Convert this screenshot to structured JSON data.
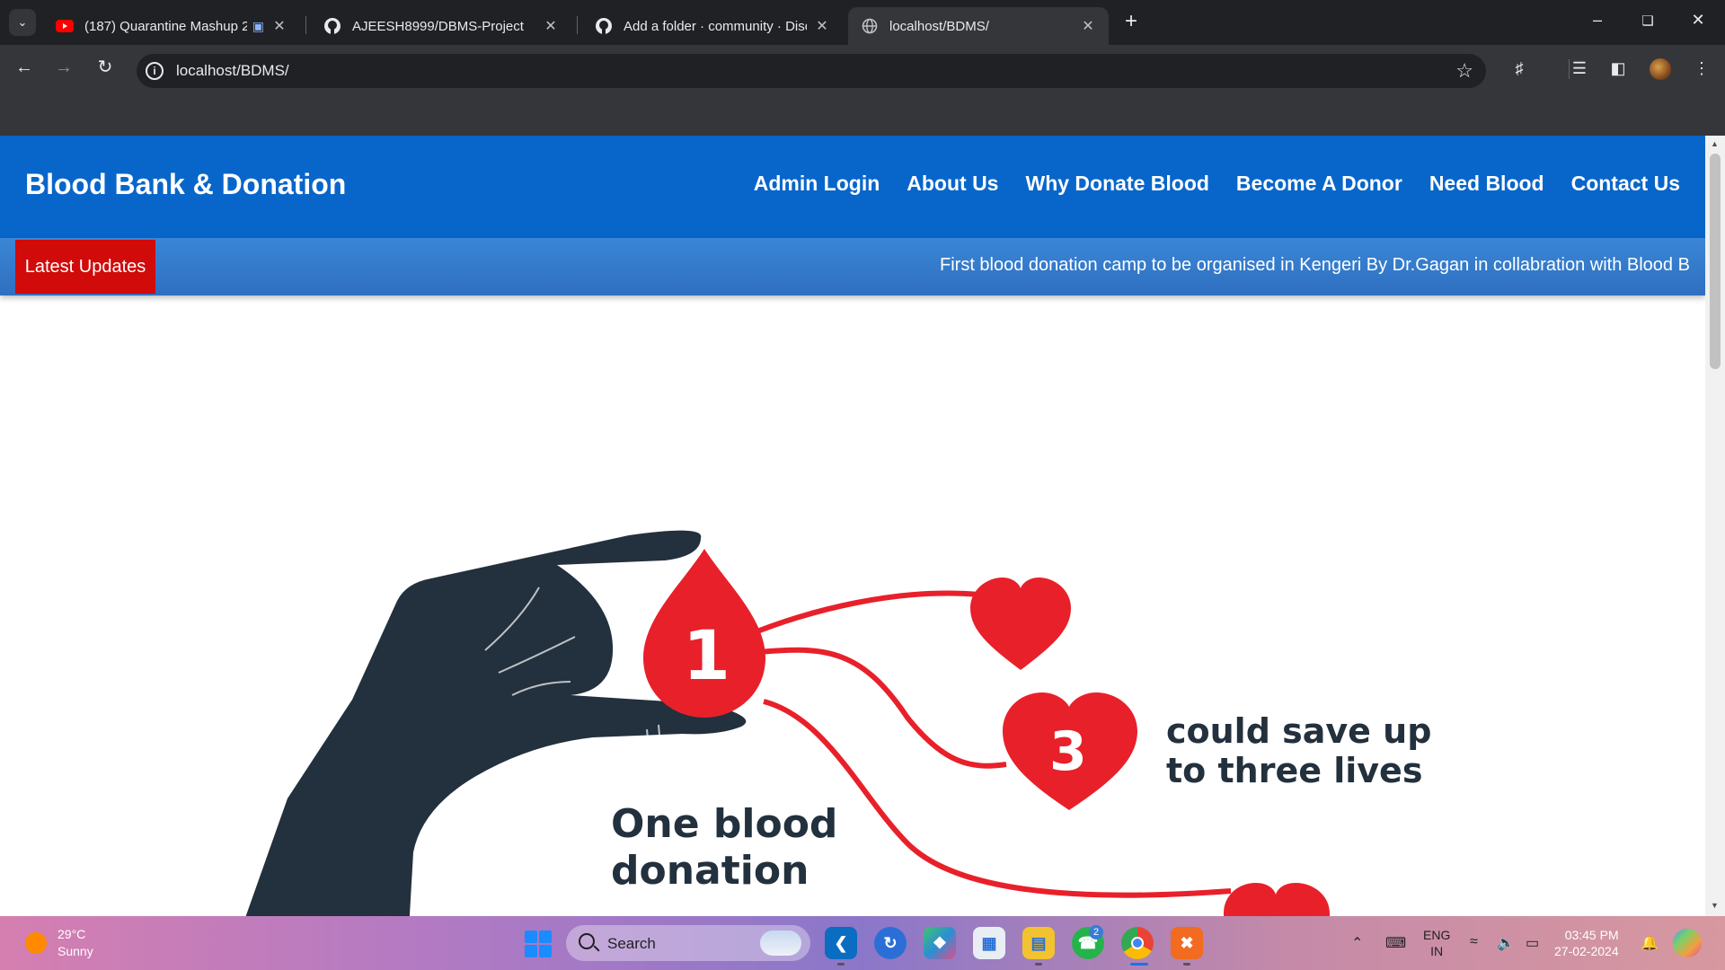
{
  "browser": {
    "tabs": [
      {
        "title": "(187) Quarantine Mashup 2",
        "icon": "youtube-icon"
      },
      {
        "title": "AJEESH8999/DBMS-Project",
        "icon": "github-icon"
      },
      {
        "title": "Add a folder · community · Disc",
        "icon": "github-icon"
      },
      {
        "title": "localhost/BDMS/",
        "icon": "globe-icon"
      }
    ],
    "url": "localhost/BDMS/"
  },
  "site": {
    "brand": "Blood Bank & Donation",
    "menu": [
      "Admin Login",
      "About Us",
      "Why Donate Blood",
      "Become A Donor",
      "Need Blood",
      "Contact Us"
    ],
    "updates_label": "Latest Updates",
    "updates_text": "First blood donation camp to be organised in Kengeri By Dr.Gagan in collabration with Blood B"
  },
  "hero": {
    "drop_number": "1",
    "heart_number": "3",
    "line1": "One blood",
    "line2": "donation",
    "line3": "could save up",
    "line4": "to three lives"
  },
  "taskbar": {
    "temperature": "29°C",
    "weather": "Sunny",
    "search_label": "Search",
    "whatsapp_badge": "2",
    "lang_line1": "ENG",
    "lang_line2": "IN",
    "time": "03:45 PM",
    "date": "27-02-2024"
  },
  "colors": {
    "header_blue": "#0866ca",
    "updates_red": "#d10a0a",
    "blood_red": "#e8202a",
    "hand_navy": "#23303d"
  }
}
